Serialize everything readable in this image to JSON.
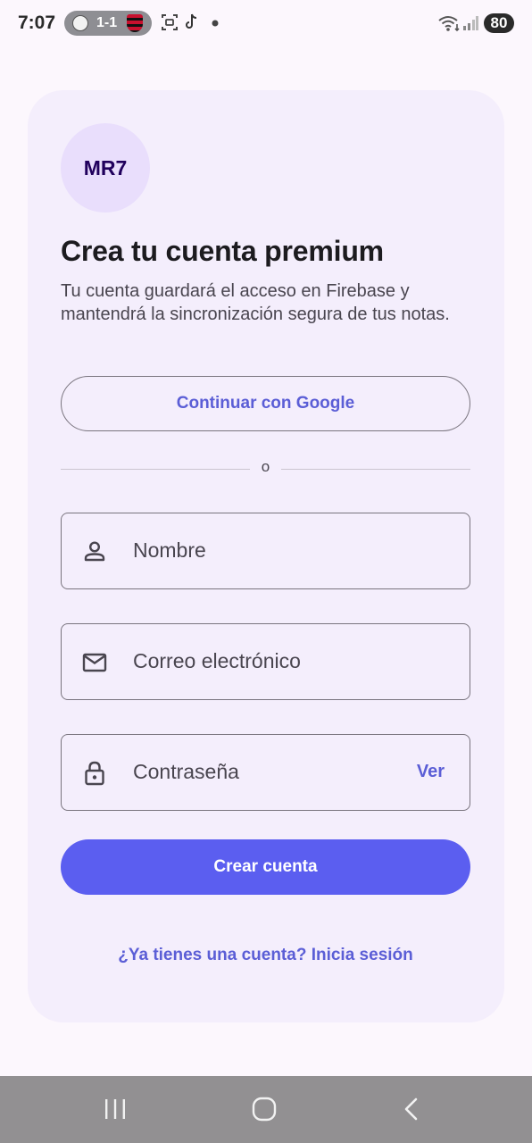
{
  "status_bar": {
    "time": "7:07",
    "score": "1-1",
    "battery": "80",
    "icons": [
      "team-crest-icon",
      "team-crest-icon",
      "screenshot-icon",
      "tiktok-icon",
      "dot-icon",
      "wifi-icon",
      "signal-icon"
    ]
  },
  "card": {
    "avatar_text": "MR7",
    "title": "Crea tu cuenta premium",
    "subtitle": "Tu cuenta guardará el acceso en Firebase y mantendrá la sincronización segura de tus notas.",
    "google_button": "Continuar con Google",
    "divider_text": "o",
    "fields": {
      "name": {
        "label": "Nombre",
        "icon": "person-icon"
      },
      "email": {
        "label": "Correo electrónico",
        "icon": "mail-icon"
      },
      "password": {
        "label": "Contraseña",
        "icon": "lock-icon",
        "toggle": "Ver"
      }
    },
    "primary_button": "Crear cuenta",
    "login_link": "¿Ya tienes una cuenta? Inicia sesión"
  },
  "nav_bar": {
    "icons": [
      "recents-icon",
      "home-icon",
      "back-icon"
    ]
  },
  "colors": {
    "accent": "#5b5ef0",
    "accent_text": "#5b5ed6",
    "card_background": "#f4eefc",
    "avatar_background": "#e9defc",
    "page_background": "#fcf7fd"
  }
}
